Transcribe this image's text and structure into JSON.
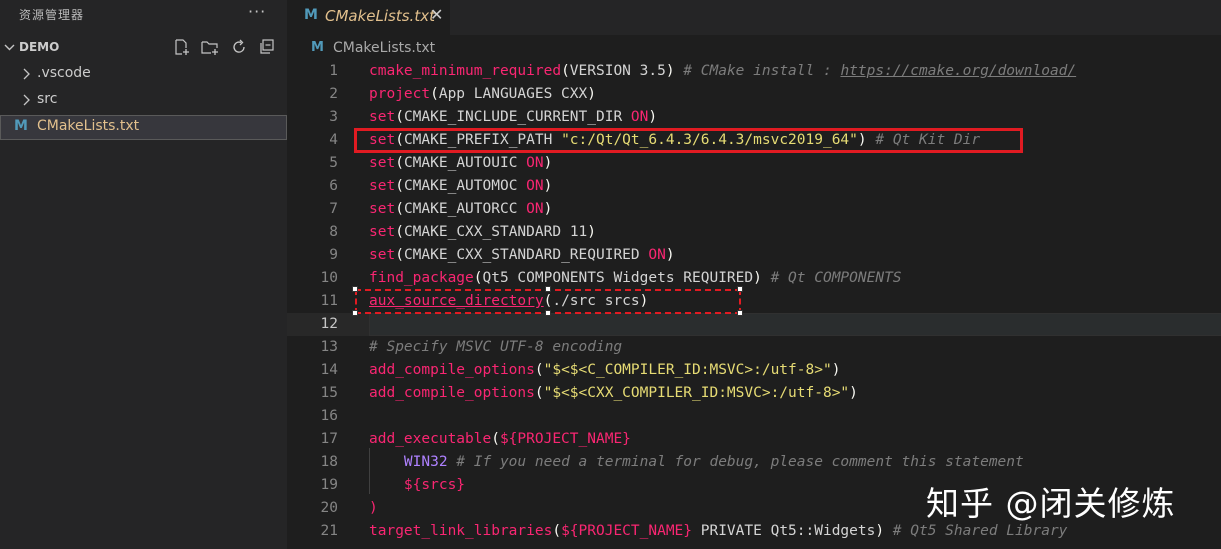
{
  "sidebar": {
    "header": "资源管理器",
    "more": "···",
    "section_title": "DEMO",
    "items": [
      {
        "label": ".vscode"
      },
      {
        "label": "src"
      },
      {
        "label": "CMakeLists.txt",
        "icon": "M"
      }
    ]
  },
  "editor": {
    "tab": {
      "label": "CMakeLists.txt",
      "icon": "M",
      "close": "✕"
    },
    "breadcrumb": {
      "label": "CMakeLists.txt",
      "icon": "M"
    },
    "line_numbers": [
      "1",
      "2",
      "3",
      "4",
      "5",
      "6",
      "7",
      "8",
      "9",
      "10",
      "11",
      "12",
      "13",
      "14",
      "15",
      "16",
      "17",
      "18",
      "19",
      "20",
      "21"
    ],
    "lines": {
      "l1": {
        "fn": "cmake_minimum_required",
        "open": "(",
        "args": "VERSION 3.5",
        "close": ")",
        "comment": " # CMake install : ",
        "url": "https://cmake.org/download/"
      },
      "l2": {
        "fn": "project",
        "open": "(",
        "args": "App LANGUAGES CXX",
        "close": ")"
      },
      "l3": {
        "fn": "set",
        "open": "(",
        "args": "CMAKE_INCLUDE_CURRENT_DIR ",
        "kw": "ON",
        "close": ")"
      },
      "l4": {
        "fn": "set",
        "open": "(",
        "args": "CMAKE_PREFIX_PATH ",
        "str": "\"c:/Qt/Qt_6.4.3/6.4.3/msvc2019_64\"",
        "close": ")",
        "comment": " # Qt Kit Dir"
      },
      "l5": {
        "fn": "set",
        "open": "(",
        "args": "CMAKE_AUTOUIC ",
        "kw": "ON",
        "close": ")"
      },
      "l6": {
        "fn": "set",
        "open": "(",
        "args": "CMAKE_AUTOMOC ",
        "kw": "ON",
        "close": ")"
      },
      "l7": {
        "fn": "set",
        "open": "(",
        "args": "CMAKE_AUTORCC ",
        "kw": "ON",
        "close": ")"
      },
      "l8": {
        "fn": "set",
        "open": "(",
        "args": "CMAKE_CXX_STANDARD ",
        "num": "11",
        "close": ")"
      },
      "l9": {
        "fn": "set",
        "open": "(",
        "args": "CMAKE_CXX_STANDARD_REQUIRED ",
        "kw": "ON",
        "close": ")"
      },
      "l10": {
        "fn": "find_package",
        "open": "(",
        "args": "Qt5 COMPONENTS Widgets REQUIRED",
        "close": ")",
        "comment": " # Qt COMPONENTS"
      },
      "l11": {
        "fn": "aux_source_directory",
        "open": "(",
        "args": "./src srcs",
        "close": ")"
      },
      "l13": {
        "comment": "# Specify MSVC UTF-8 encoding"
      },
      "l14": {
        "fn": "add_compile_options",
        "open": "(",
        "str": "\"$<$<C_COMPILER_ID:MSVC>:/utf-8>\"",
        "close": ")"
      },
      "l15": {
        "fn": "add_compile_options",
        "open": "(",
        "str": "\"$<$<CXX_COMPILER_ID:MSVC>:/utf-8>\"",
        "close": ")"
      },
      "l17": {
        "fn": "add_executable",
        "open": "(",
        "var": "${PROJECT_NAME}"
      },
      "l18": {
        "indent": "    ",
        "v": "WIN32",
        "comment": " # If you need a terminal for debug, please comment this statement"
      },
      "l19": {
        "indent": "    ",
        "var": "${srcs}"
      },
      "l20": {
        "close": ")"
      },
      "l21": {
        "fn": "target_link_libraries",
        "open": "(",
        "var": "${PROJECT_NAME}",
        "args": " PRIVATE Qt5::Widgets",
        "close": ")",
        "comment": " # Qt5 Shared Library"
      }
    }
  },
  "watermark": "知乎 @闭关修炼",
  "colors": {
    "function": "#f92672",
    "string": "#e6db74",
    "comment": "#7c7c7c",
    "keyword": "#f92672",
    "highlight": "#e11b22"
  }
}
